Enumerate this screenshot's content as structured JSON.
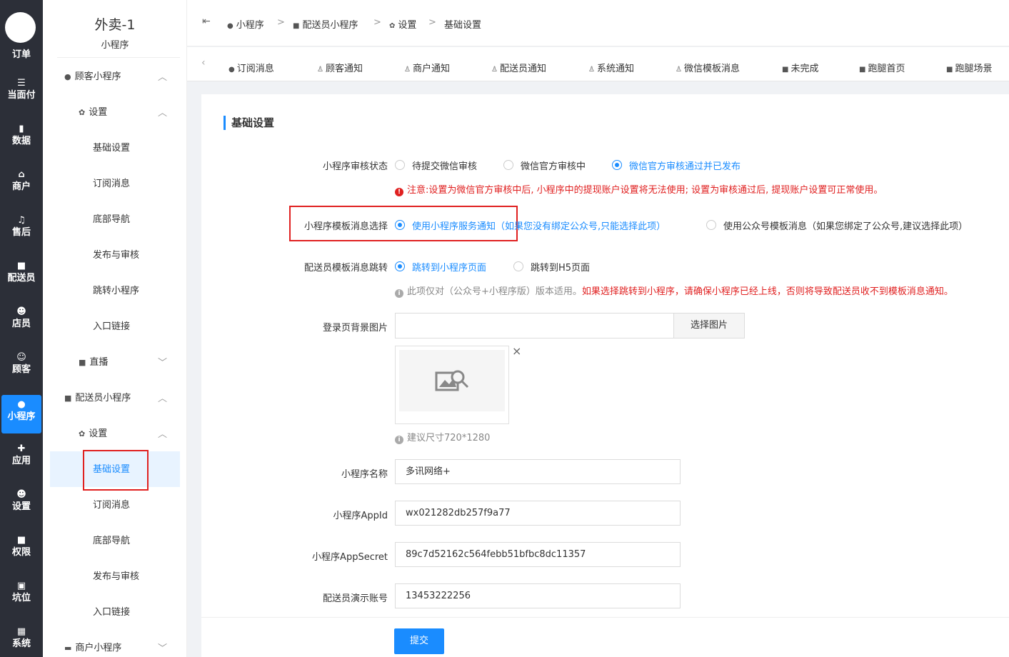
{
  "rail": {
    "top_label": "订单",
    "items": [
      {
        "label": "当面付",
        "icon": "list-icon"
      },
      {
        "label": "数据",
        "icon": "bar-chart-icon"
      },
      {
        "label": "商户",
        "icon": "store-icon"
      },
      {
        "label": "售后",
        "icon": "headset-icon"
      },
      {
        "label": "配送员",
        "icon": "truck-icon"
      },
      {
        "label": "店员",
        "icon": "staff-icon"
      },
      {
        "label": "顾客",
        "icon": "customer-icon"
      },
      {
        "label": "小程序",
        "icon": "wechat-icon"
      },
      {
        "label": "应用",
        "icon": "apps-icon"
      },
      {
        "label": "设置",
        "icon": "user-settings-icon"
      },
      {
        "label": "权限",
        "icon": "lock-icon"
      },
      {
        "label": "坑位",
        "icon": "slot-icon"
      },
      {
        "label": "系统",
        "icon": "windows-icon"
      }
    ]
  },
  "sidebar": {
    "title": "外卖-1",
    "subtitle": "小程序",
    "menu": {
      "customer_app": "顾客小程序",
      "settings_1": "设置",
      "basic_1": "基础设置",
      "subscribe_1": "订阅消息",
      "bottom_nav_1": "底部导航",
      "publish_1": "发布与审核",
      "jump_1": "跳转小程序",
      "entry_1": "入口链接",
      "live": "直播",
      "courier_app": "配送员小程序",
      "settings_2": "设置",
      "basic_2": "基础设置",
      "subscribe_2": "订阅消息",
      "bottom_nav_2": "底部导航",
      "publish_2": "发布与审核",
      "entry_2": "入口链接",
      "merchant_app": "商户小程序"
    }
  },
  "breadcrumb": [
    "小程序",
    "配送员小程序",
    "设置",
    "基础设置"
  ],
  "tabs": [
    "订阅消息",
    "顾客通知",
    "商户通知",
    "配送员通知",
    "系统通知",
    "微信模板消息",
    "未完成",
    "跑腿首页",
    "跑腿场景"
  ],
  "form": {
    "section_title": "基础设置",
    "audit": {
      "label": "小程序审核状态",
      "options": [
        "待提交微信审核",
        "微信官方审核中",
        "微信官方审核通过并已发布"
      ],
      "selected": 2,
      "note": "注意:设置为微信官方审核中后, 小程序中的提现账户设置将无法使用; 设置为审核通过后, 提现账户设置可正常使用。"
    },
    "template": {
      "label": "小程序模板消息选择",
      "option1": "使用小程序服务通知",
      "option1_hint": "（如果您没有绑定公众号,只能选择此项）",
      "option2": "使用公众号模板消息（如果您绑定了公众号,建议选择此项）",
      "selected": 0
    },
    "jump": {
      "label": "配送员模板消息跳转",
      "options": [
        "跳转到小程序页面",
        "跳转到H5页面"
      ],
      "selected": 0,
      "note_gray": "此项仅对（公众号+小程序版）版本适用。",
      "note_red": "如果选择跳转到小程序，请确保小程序已经上线，否则将导致配送员收不到模板消息通知。"
    },
    "bg_image": {
      "label": "登录页背景图片",
      "value": "",
      "button": "选择图片",
      "close": "×",
      "hint": "建议尺寸720*1280"
    },
    "name": {
      "label": "小程序名称",
      "value": "多讯网络+"
    },
    "appid": {
      "label": "小程序AppId",
      "value": "wx021282db257f9a77"
    },
    "secret": {
      "label": "小程序AppSecret",
      "value": "89c7d52162c564febb51bfbc8dc11357"
    },
    "demo": {
      "label": "配送员演示账号",
      "value": "13453222256"
    },
    "submit": "提交"
  },
  "colors": {
    "accent": "#1a8cff",
    "warning": "#e02020",
    "rail_bg": "#2c2f38"
  }
}
